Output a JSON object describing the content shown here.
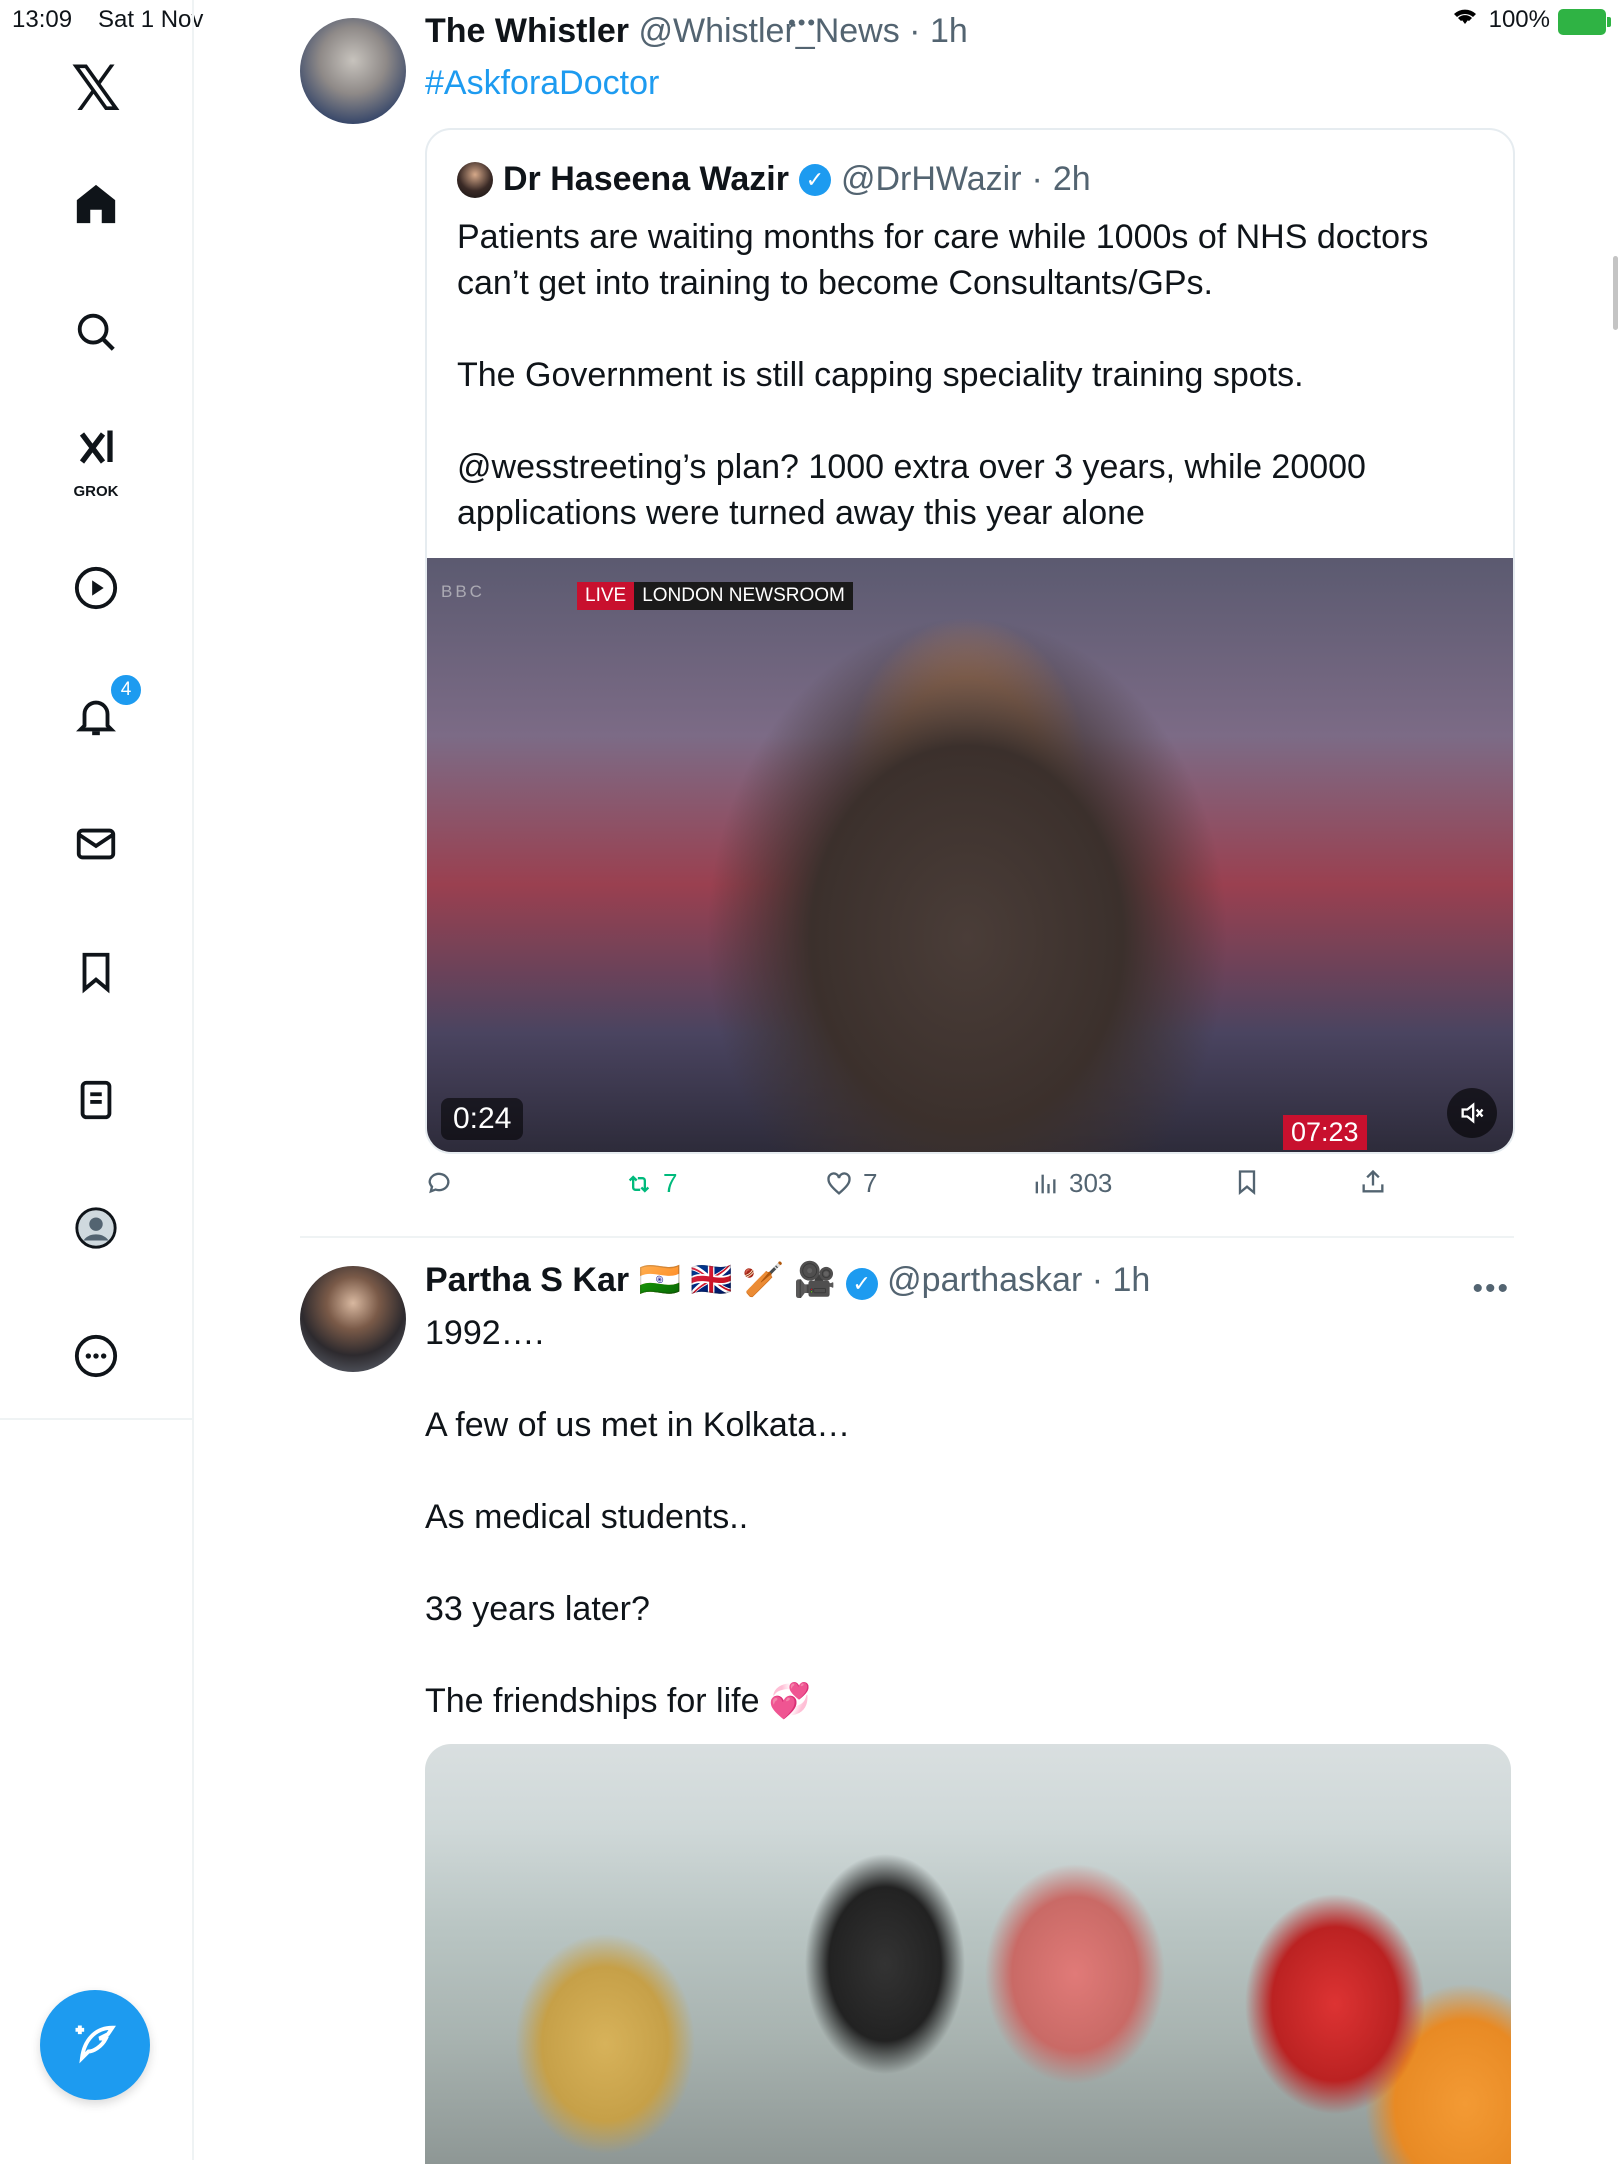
{
  "status_bar": {
    "time": "13:09",
    "date": "Sat 1 Nov",
    "battery": "100%"
  },
  "sidebar": {
    "logo": "𝕏",
    "items": [
      {
        "name": "home",
        "icon": "home-icon"
      },
      {
        "name": "explore",
        "icon": "search-icon"
      },
      {
        "name": "grok",
        "icon": "grok-icon",
        "label": "GROK"
      },
      {
        "name": "videos",
        "icon": "play-icon"
      },
      {
        "name": "notifications",
        "icon": "bell-icon",
        "badge": "4"
      },
      {
        "name": "messages",
        "icon": "mail-icon"
      },
      {
        "name": "bookmarks",
        "icon": "bookmark-icon"
      },
      {
        "name": "lists",
        "icon": "list-icon"
      },
      {
        "name": "profile",
        "icon": "avatar-icon"
      },
      {
        "name": "more",
        "icon": "more-icon"
      }
    ]
  },
  "tweet1": {
    "name": "The Whistler",
    "handle": "@Whistler_News",
    "time": "1h",
    "hashtag": "#AskforaDoctor",
    "quote": {
      "name": "Dr Haseena Wazir",
      "handle": "@DrHWazir",
      "time": "2h",
      "para1": "Patients are waiting months for care while 1000s of NHS doctors can’t get into training to become Consultants/GPs.",
      "para2": "The Government is still capping speciality training spots.",
      "para3": "@wesstreeting’s plan? 1000 extra over 3 years, while 20000 applications were turned away this year alone",
      "video": {
        "bbc": "BBC",
        "live": "LIVE",
        "newsroom": "LONDON NEWSROOM",
        "elapsed": "0:24",
        "clock": "07:23"
      }
    },
    "actions": {
      "replies": "",
      "reposts": "7",
      "likes": "7",
      "views": "303"
    }
  },
  "tweet2": {
    "name": "Partha S Kar",
    "flags": "🇮🇳 🇬🇧 🏏 🎥",
    "handle": "@parthaskar",
    "time": "1h",
    "lines": [
      "1992….",
      "A few of us met in Kolkata…",
      "As medical students..",
      "33 years later?",
      "The friendships for life 💞"
    ]
  },
  "colors": {
    "accent": "#1d9bf0",
    "repost": "#00ba7c",
    "text": "#0f1419",
    "muted": "#536471"
  }
}
